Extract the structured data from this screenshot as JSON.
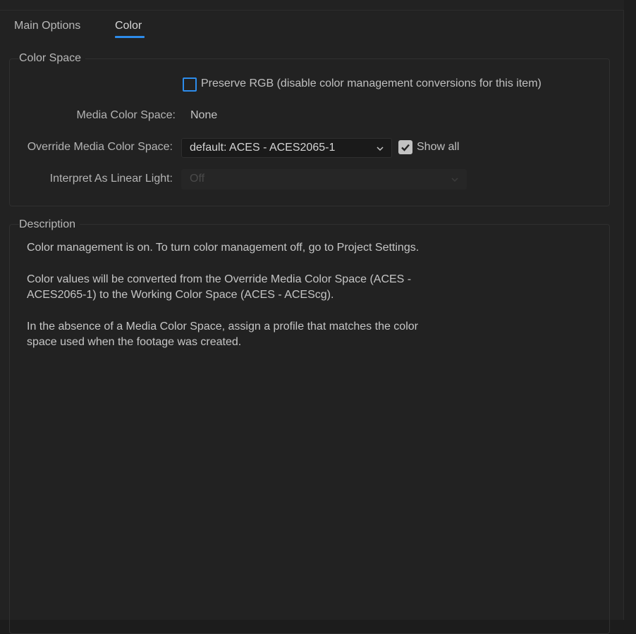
{
  "tabs": [
    {
      "label": "Main Options",
      "active": false
    },
    {
      "label": "Color",
      "active": true
    }
  ],
  "colors": {
    "accent": "#2d8ceb",
    "background": "#222222"
  },
  "color_space": {
    "title": "Color Space",
    "preserve_rgb": {
      "checked": false,
      "label": "Preserve RGB (disable color management conversions for this item)"
    },
    "media_color_space": {
      "label": "Media Color Space:",
      "value": "None"
    },
    "override_media_color_space": {
      "label": "Override Media Color Space:",
      "selected": "default: ACES - ACES2065-1"
    },
    "show_all": {
      "checked": true,
      "label": "Show all"
    },
    "interpret_as_linear_light": {
      "label": "Interpret As Linear Light:",
      "selected": "Off",
      "disabled": true
    }
  },
  "description": {
    "title": "Description",
    "paragraphs": [
      "Color management is on. To turn color management off, go to Project Settings.",
      "Color values will be converted from the Override Media Color Space (ACES - ACES2065-1) to the Working Color Space (ACES - ACEScg).",
      "In the absence of a Media Color Space, assign a profile that matches the color space used when the footage was created."
    ]
  }
}
